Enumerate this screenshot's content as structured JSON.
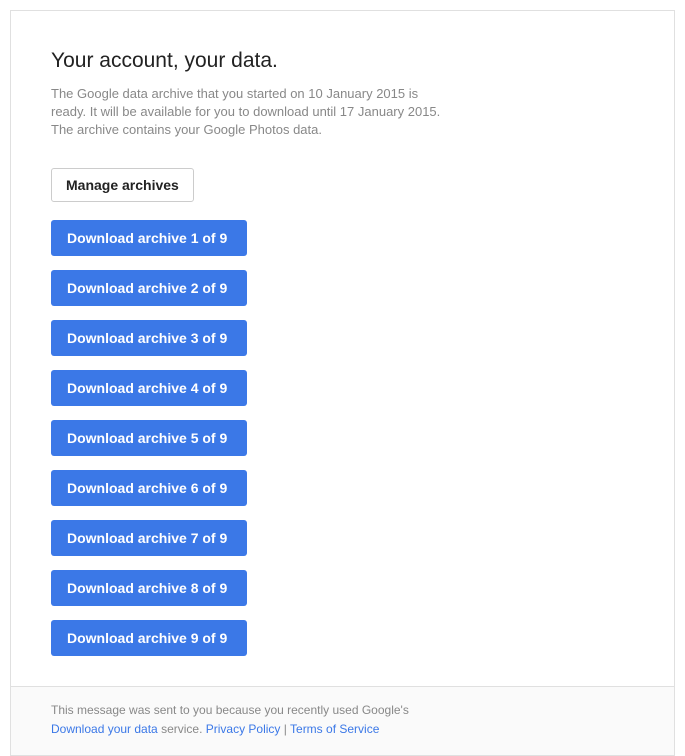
{
  "title": "Your account, your data.",
  "description": "The Google data archive that you started on 10 January 2015 is ready. It will be available for you to download until 17 January 2015. The archive contains your Google Photos data.",
  "manage_label": "Manage archives",
  "downloads": [
    "Download archive 1 of 9",
    "Download archive 2 of 9",
    "Download archive 3 of 9",
    "Download archive 4 of 9",
    "Download archive 5 of 9",
    "Download archive 6 of 9",
    "Download archive 7 of 9",
    "Download archive 8 of 9",
    "Download archive 9 of 9"
  ],
  "footer": {
    "line1_prefix": "This message was sent to you because you recently used Google's",
    "download_link": "Download your data",
    "service_text": " service. ",
    "privacy_link": "Privacy Policy",
    "separator": " | ",
    "terms_link": "Terms of Service"
  }
}
